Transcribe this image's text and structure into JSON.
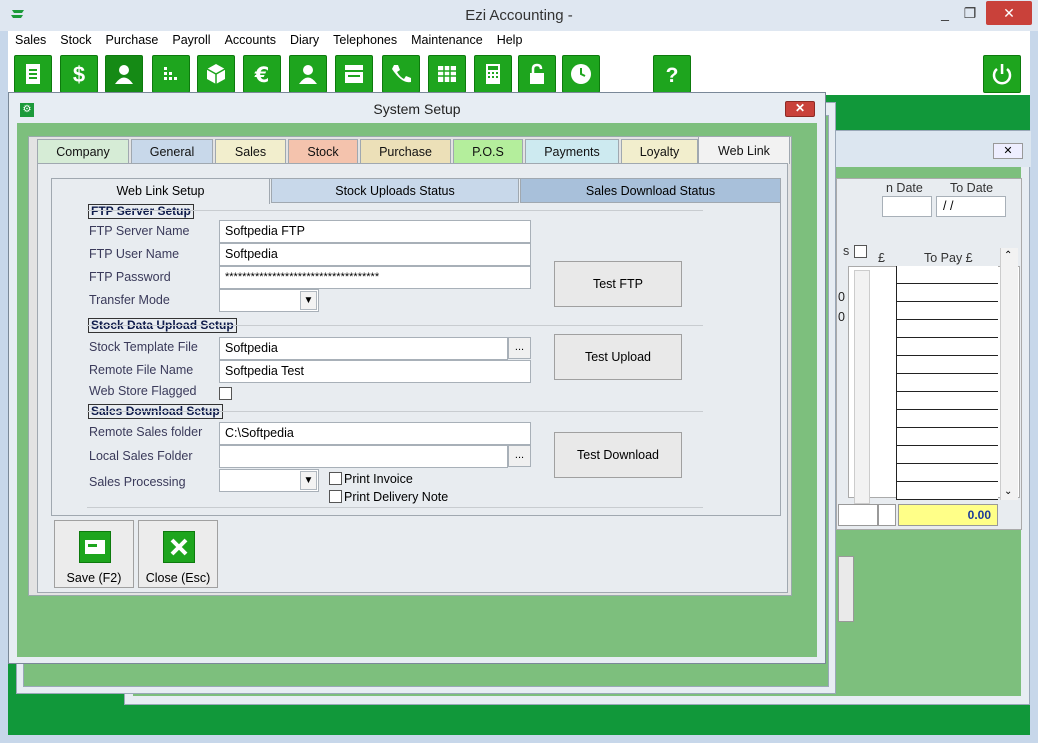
{
  "window": {
    "title": "Ezi Accounting -"
  },
  "menu": [
    "Sales",
    "Stock",
    "Purchase",
    "Payroll",
    "Accounts",
    "Diary",
    "Telephones",
    "Maintenance",
    "Help"
  ],
  "toolbar": {
    "icons": [
      "document-icon",
      "dollar-icon",
      "person-icon",
      "dots-icon",
      "box-icon",
      "euro-icon",
      "contact-icon",
      "register-icon",
      "phone-icon",
      "grid-icon",
      "calculator-icon",
      "lock-icon",
      "clock-icon",
      "help-icon",
      "power-icon"
    ]
  },
  "background": {
    "date_from_label": "n Date",
    "date_to_label": "To Date",
    "date_to_value": "/ /",
    "to_pay_header": "To Pay £",
    "col_cut_header": "£",
    "row_fragment": "s",
    "total_value": "0.00",
    "left_fragment_1": "0",
    "left_fragment_2": "0",
    "bottom_fragment": "0"
  },
  "dialog": {
    "title": "System Setup",
    "tabs": [
      {
        "label": "Company",
        "color": "#d6ecd6"
      },
      {
        "label": "General",
        "color": "#c8d8ea"
      },
      {
        "label": "Sales",
        "color": "#f2eecd"
      },
      {
        "label": "Stock",
        "color": "#f4c3ad"
      },
      {
        "label": "Purchase",
        "color": "#ece0b8"
      },
      {
        "label": "P.O.S",
        "color": "#b4ee9c"
      },
      {
        "label": "Payments",
        "color": "#cdeaf0"
      },
      {
        "label": "Loyalty",
        "color": "#f2eecd"
      },
      {
        "label": "Web Link",
        "color": "#f2f2f2"
      }
    ],
    "subtabs": [
      "Web Link Setup",
      "Stock Uploads Status",
      "Sales Download Status"
    ],
    "ftp": {
      "section": "FTP Server Setup",
      "server_name_label": "FTP Server Name",
      "server_name": "Softpedia FTP",
      "user_name_label": "FTP User Name",
      "user_name": "Softpedia",
      "password_label": "FTP Password",
      "password": "************************************",
      "transfer_mode_label": "Transfer Mode",
      "transfer_mode": "",
      "test_button": "Test FTP"
    },
    "upload": {
      "section": "Stock Data Upload Setup",
      "template_label": "Stock Template File",
      "template": "Softpedia",
      "remote_label": "Remote File Name",
      "remote": "Softpedia Test",
      "flagged_label": "Web Store Flagged",
      "test_button": "Test Upload"
    },
    "download": {
      "section": "Sales Download Setup",
      "remote_folder_label": "Remote Sales folder",
      "remote_folder": "C:\\Softpedia",
      "local_folder_label": "Local Sales Folder",
      "local_folder": "",
      "processing_label": "Sales Processing",
      "processing": "",
      "print_invoice": "Print Invoice",
      "print_delivery": "Print Delivery Note",
      "test_button": "Test Download"
    },
    "browse": "...",
    "save_button": "Save (F2)",
    "close_button": "Close (Esc)"
  }
}
